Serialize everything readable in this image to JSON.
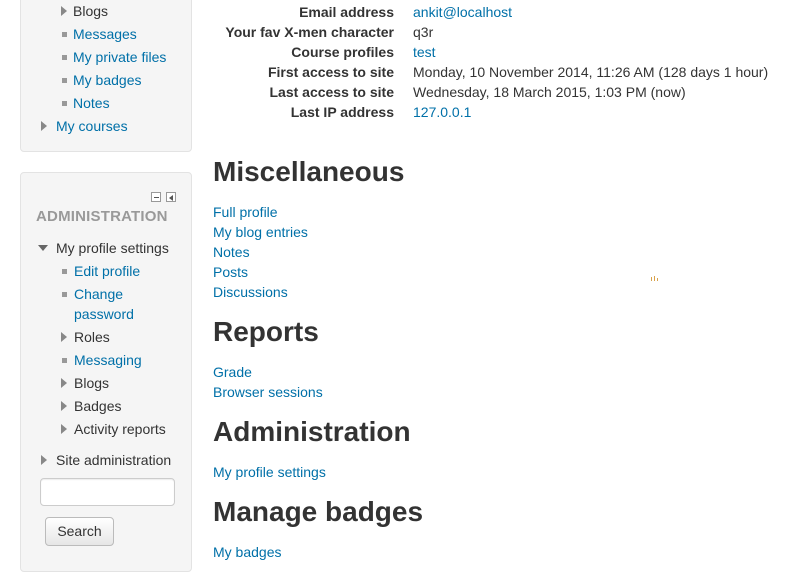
{
  "navigation": {
    "items": [
      {
        "label": "Blogs"
      },
      {
        "label": "Messages"
      },
      {
        "label": "My private files"
      },
      {
        "label": "My badges"
      },
      {
        "label": "Notes"
      }
    ],
    "my_courses": "My courses"
  },
  "administration": {
    "title": "ADMINISTRATION",
    "profile_settings": "My profile settings",
    "edit_profile": "Edit profile",
    "change_password_line1": "Change",
    "change_password_line2": "password",
    "roles": "Roles",
    "messaging": "Messaging",
    "blogs": "Blogs",
    "badges": "Badges",
    "activity_reports": "Activity reports",
    "site_admin": "Site administration",
    "search_value": "",
    "search_button": "Search"
  },
  "profile": [
    {
      "label": "Email address",
      "value": "ankit@localhost",
      "link": true
    },
    {
      "label": "Your fav X-men character",
      "value": "q3r",
      "link": false
    },
    {
      "label": "Course profiles",
      "value": "test",
      "link": true
    },
    {
      "label": "First access to site",
      "value": "Monday, 10 November 2014, 11:26 AM  (128 days 1 hour)",
      "link": false
    },
    {
      "label": "Last access to site",
      "value": "Wednesday, 18 March 2015, 1:03 PM  (now)",
      "link": false
    },
    {
      "label": "Last IP address",
      "value": "127.0.0.1",
      "link": true
    }
  ],
  "sections": {
    "misc": {
      "heading": "Miscellaneous",
      "links": [
        "Full profile",
        "My blog entries",
        "Notes",
        "Posts",
        "Discussions"
      ]
    },
    "reports": {
      "heading": "Reports",
      "links": [
        "Grade",
        "Browser sessions"
      ]
    },
    "administration": {
      "heading": "Administration",
      "links": [
        "My profile settings"
      ]
    },
    "badges": {
      "heading": "Manage badges",
      "links": [
        "My badges"
      ]
    }
  },
  "colors": {
    "link": "#0070a8",
    "text": "#333333",
    "block_bg": "#f5f5f5"
  }
}
